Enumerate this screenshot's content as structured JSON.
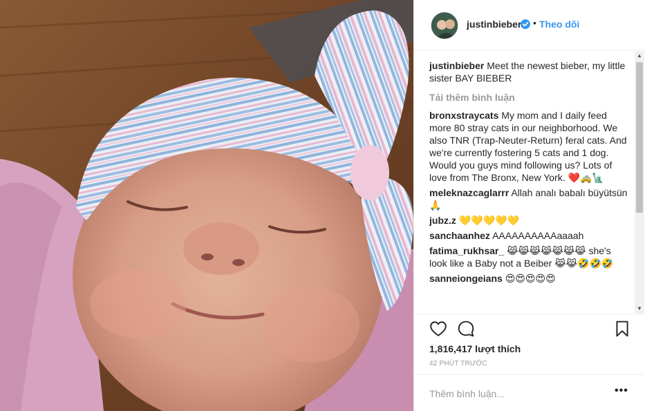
{
  "header": {
    "username": "justinbieber",
    "separator": "•",
    "follow_label": "Theo dõi"
  },
  "caption": {
    "username": "justinbieber",
    "text": "Meet the newest bieber, my little sister BAY BIEBER"
  },
  "load_more_label": "Tải thêm bình luận",
  "comments": [
    {
      "username": "bronxstraycats",
      "text": "My mom and I daily feed more 80 stray cats in our neighborhood. We also TNR (Trap-Neuter-Return) feral cats. And we're currently fostering 5 cats and 1 dog. Would you guys mind following us? Lots of love from The Bronx, New York. ❤️🚕🗽"
    },
    {
      "username": "meleknazcaglarrr",
      "text": "Allah analı babalı büyütsün 🙏"
    },
    {
      "username": "jubz.z",
      "text": "💛💛💛💛💛"
    },
    {
      "username": "sanchaanhez",
      "text": "AAAAAAAAAAaaaah"
    },
    {
      "username": "fatima_rukhsar_",
      "text": "😹😹😹😹😹😹😹 she's look like a Baby not a Beiber 😹😹🤣🤣🤣"
    },
    {
      "username": "sanneiongeians",
      "text": "😍😍😍😍😍"
    }
  ],
  "likes_text": "1,816,417 lượt thích",
  "time_text": "42 PHÚT TRƯỚC",
  "comment_input": {
    "placeholder": "Thêm bình luận..."
  },
  "more_label": "•••",
  "icons": {
    "heart": "heart-icon",
    "comment": "comment-icon",
    "bookmark": "bookmark-icon",
    "verified": "verified-badge-icon"
  },
  "colors": {
    "accent": "#3897f0",
    "muted": "#999999",
    "text": "#262626",
    "border": "#efefef"
  }
}
